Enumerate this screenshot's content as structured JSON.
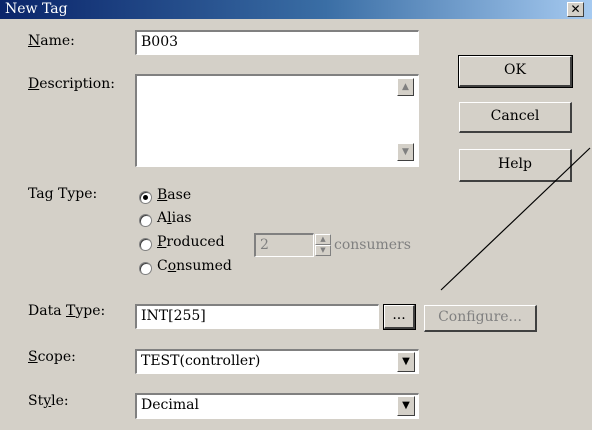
{
  "window": {
    "title": "New Tag",
    "close_glyph": "✕"
  },
  "name": {
    "label_pre": "",
    "label_key": "N",
    "label_post": "ame:",
    "value": "B003"
  },
  "description": {
    "label_pre": "",
    "label_key": "D",
    "label_post": "escription:",
    "value": ""
  },
  "tag_type": {
    "label": "Tag Type:",
    "options": [
      {
        "pre": "",
        "key": "B",
        "post": "ase",
        "checked": true
      },
      {
        "pre": "A",
        "key": "l",
        "post": "ias",
        "checked": false
      },
      {
        "pre": "",
        "key": "P",
        "post": "roduced",
        "checked": false
      },
      {
        "pre": "C",
        "key": "o",
        "post": "nsumed",
        "checked": false
      }
    ],
    "consumers_value": "2",
    "consumers_label": "consumers"
  },
  "data_type": {
    "label_pre": "Data ",
    "label_key": "T",
    "label_post": "ype:",
    "value": "INT[255]",
    "browse_label": "...",
    "configure_label": "Configure..."
  },
  "scope": {
    "label_pre": "",
    "label_key": "S",
    "label_post": "cope:",
    "value": "TEST(controller)"
  },
  "style": {
    "label_pre": "St",
    "label_key": "y",
    "label_post": "le:",
    "value": "Decimal"
  },
  "buttons": {
    "ok": "OK",
    "cancel": "Cancel",
    "help": "Help"
  }
}
